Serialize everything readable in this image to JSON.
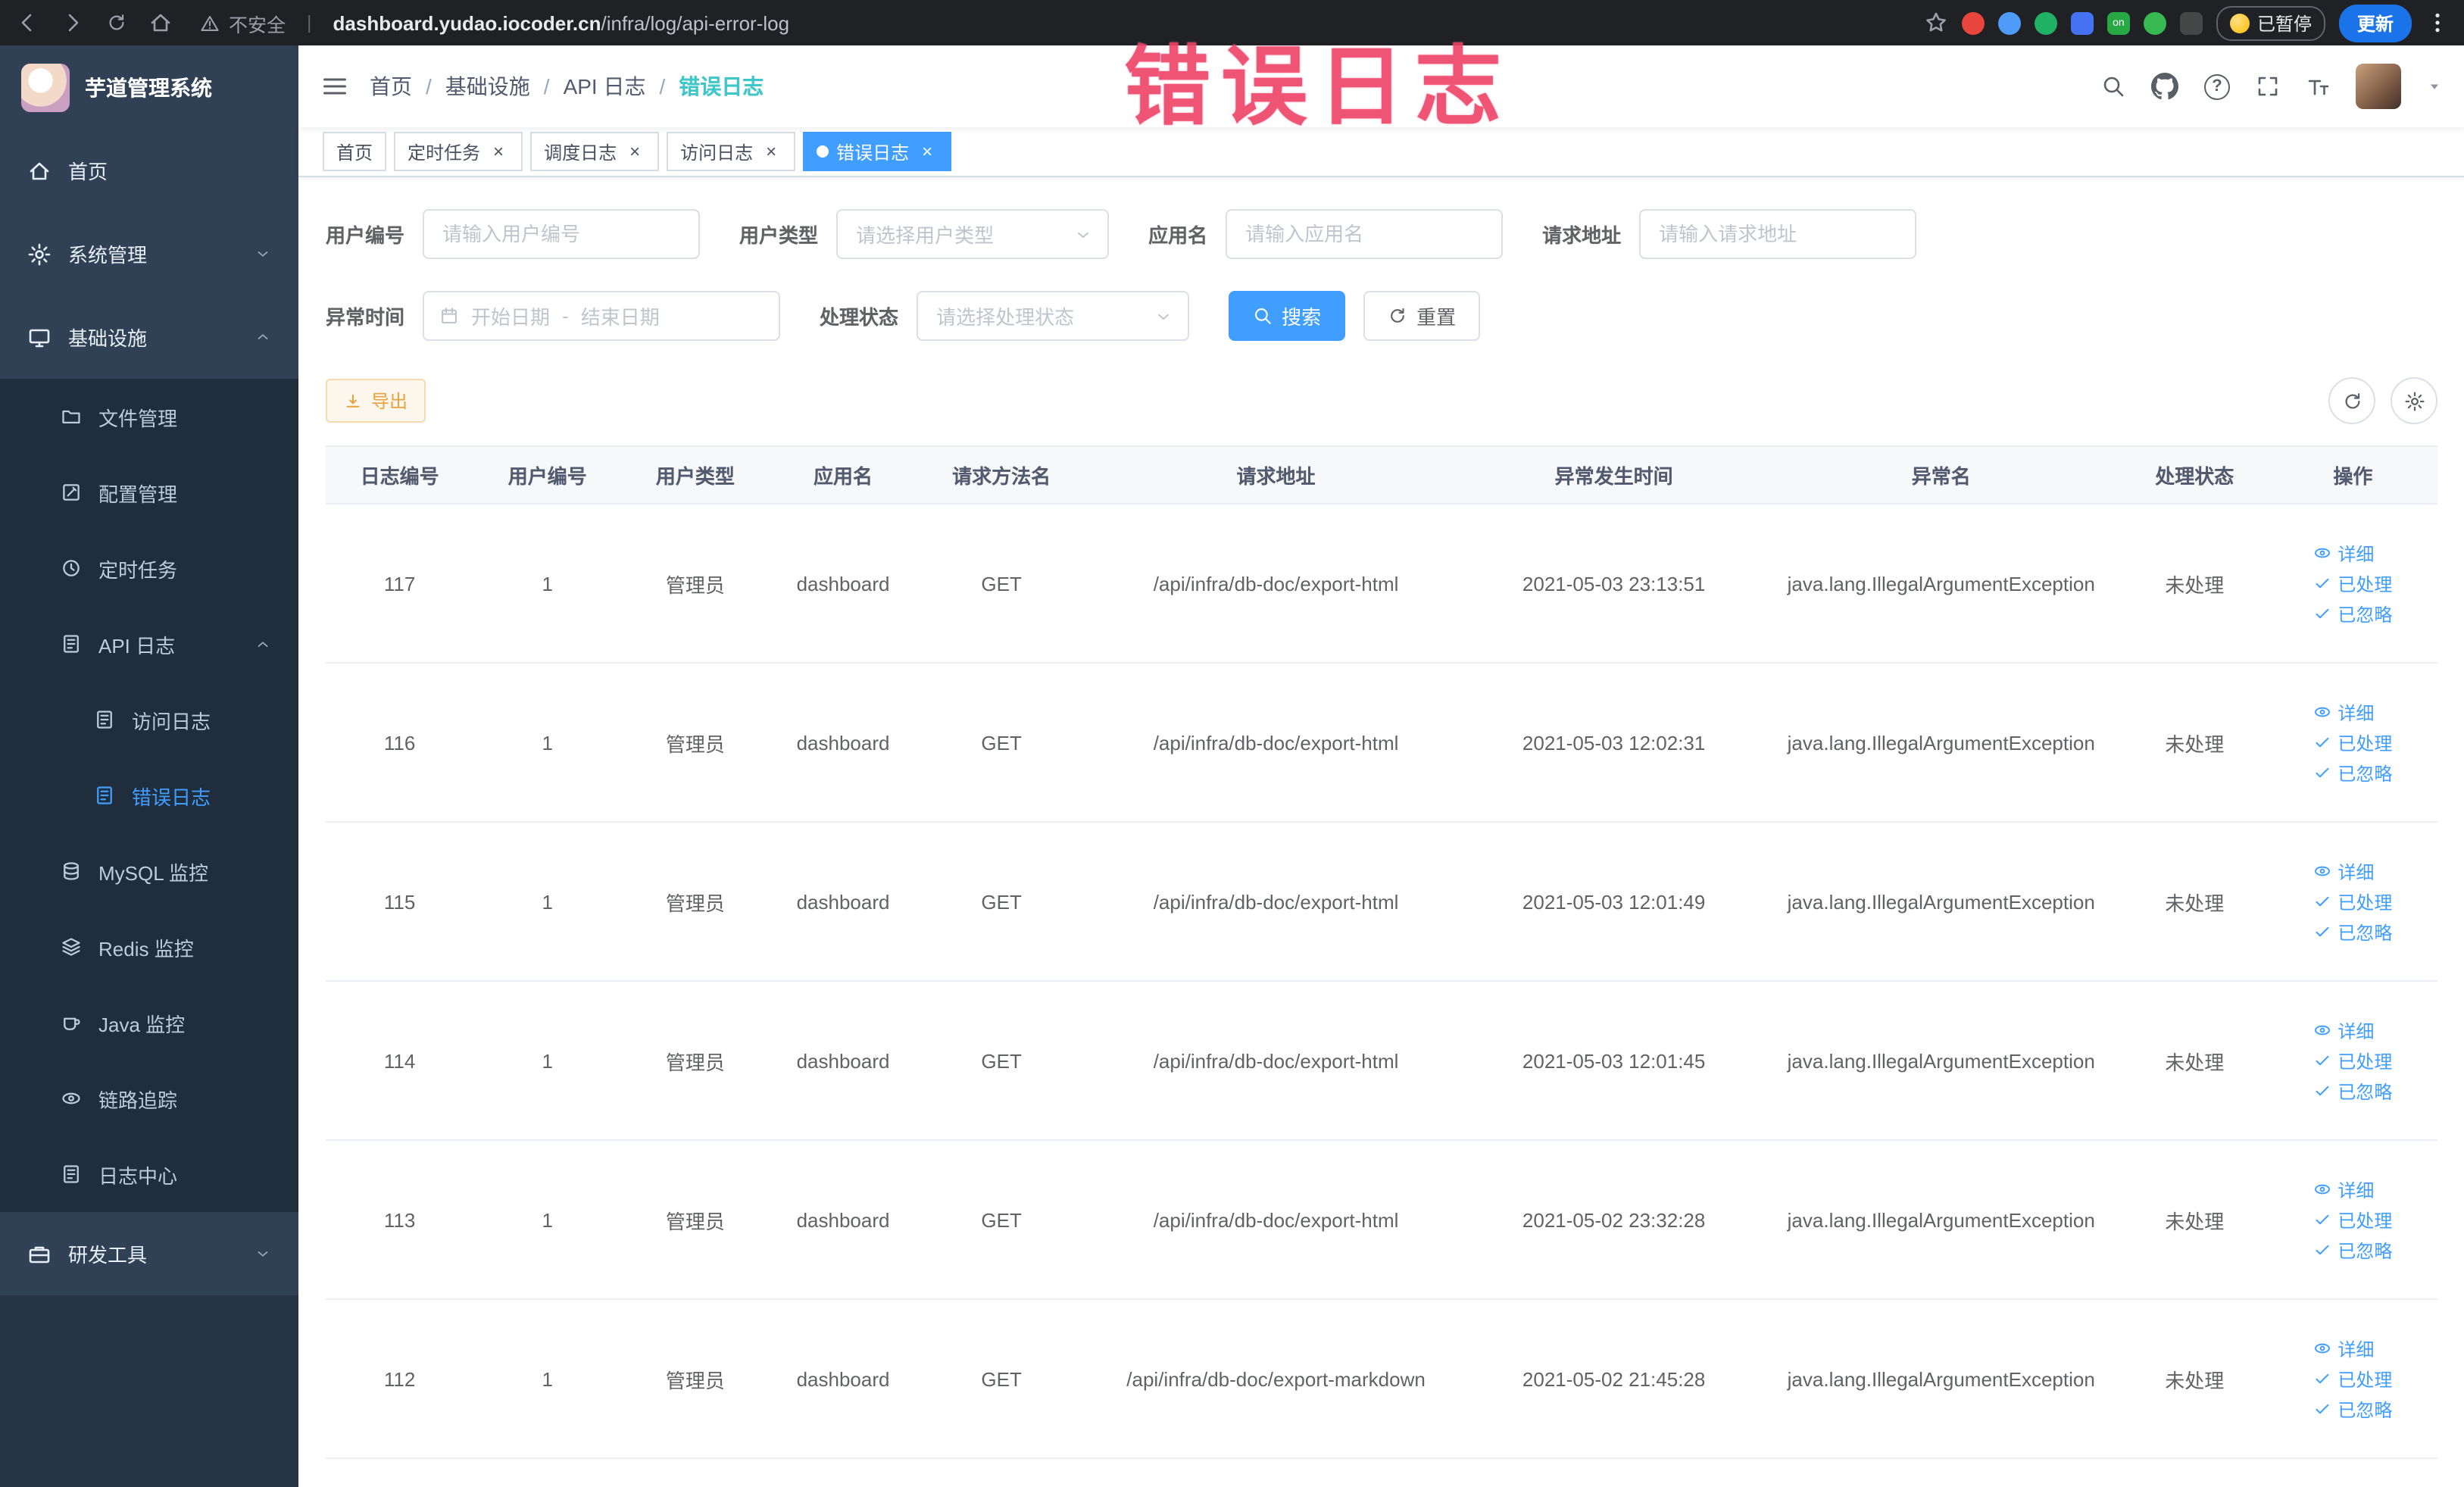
{
  "browser": {
    "security_label": "不安全",
    "url_domain": "dashboard.yudao.iocoder.cn",
    "url_path": "/infra/log/api-error-log",
    "extension_on_label": "on",
    "paused_badge": "已暂停",
    "update_button": "更新"
  },
  "annotation": {
    "text": "错误日志"
  },
  "glyphs": {
    "close": "×",
    "question": "?"
  },
  "sidebar": {
    "title": "芋道管理系统",
    "home": "首页",
    "system_mgmt": "系统管理",
    "infrastructure": "基础设施",
    "file_mgmt": "文件管理",
    "config_mgmt": "配置管理",
    "scheduled_jobs": "定时任务",
    "api_logs": "API 日志",
    "access_log": "访问日志",
    "error_log": "错误日志",
    "mysql_monitor": "MySQL 监控",
    "redis_monitor": "Redis 监控",
    "java_monitor": "Java 监控",
    "trace": "链路追踪",
    "log_center": "日志中心",
    "dev_tools": "研发工具"
  },
  "header": {
    "breadcrumb": [
      "首页",
      "基础设施",
      "API 日志",
      "错误日志"
    ],
    "breadcrumb_separator": "/"
  },
  "tags": {
    "items": [
      {
        "label": "首页"
      },
      {
        "label": "定时任务"
      },
      {
        "label": "调度日志"
      },
      {
        "label": "访问日志"
      },
      {
        "label": "错误日志"
      }
    ]
  },
  "filters": {
    "user_id_label": "用户编号",
    "user_id_placeholder": "请输入用户编号",
    "user_type_label": "用户类型",
    "user_type_placeholder": "请选择用户类型",
    "app_name_label": "应用名",
    "app_name_placeholder": "请输入应用名",
    "request_url_label": "请求地址",
    "request_url_placeholder": "请输入请求地址",
    "exception_time_label": "异常时间",
    "start_date_placeholder": "开始日期",
    "date_separator": "-",
    "end_date_placeholder": "结束日期",
    "process_status_label": "处理状态",
    "process_status_placeholder": "请选择处理状态",
    "search_button": "搜索",
    "reset_button": "重置"
  },
  "toolbar": {
    "export_button": "导出"
  },
  "table": {
    "columns": [
      "日志编号",
      "用户编号",
      "用户类型",
      "应用名",
      "请求方法名",
      "请求地址",
      "异常发生时间",
      "异常名",
      "处理状态",
      "操作"
    ],
    "actions": {
      "detail": "详细",
      "processed": "已处理",
      "ignored": "已忽略"
    },
    "rows": [
      {
        "log_id": "117",
        "user_id": "1",
        "user_type": "管理员",
        "app_name": "dashboard",
        "method": "GET",
        "url": "/api/infra/db-doc/export-html",
        "time": "2021-05-03 23:13:51",
        "exception": "java.lang.IllegalArgumentException",
        "status": "未处理"
      },
      {
        "log_id": "116",
        "user_id": "1",
        "user_type": "管理员",
        "app_name": "dashboard",
        "method": "GET",
        "url": "/api/infra/db-doc/export-html",
        "time": "2021-05-03 12:02:31",
        "exception": "java.lang.IllegalArgumentException",
        "status": "未处理"
      },
      {
        "log_id": "115",
        "user_id": "1",
        "user_type": "管理员",
        "app_name": "dashboard",
        "method": "GET",
        "url": "/api/infra/db-doc/export-html",
        "time": "2021-05-03 12:01:49",
        "exception": "java.lang.IllegalArgumentException",
        "status": "未处理"
      },
      {
        "log_id": "114",
        "user_id": "1",
        "user_type": "管理员",
        "app_name": "dashboard",
        "method": "GET",
        "url": "/api/infra/db-doc/export-html",
        "time": "2021-05-03 12:01:45",
        "exception": "java.lang.IllegalArgumentException",
        "status": "未处理"
      },
      {
        "log_id": "113",
        "user_id": "1",
        "user_type": "管理员",
        "app_name": "dashboard",
        "method": "GET",
        "url": "/api/infra/db-doc/export-html",
        "time": "2021-05-02 23:32:28",
        "exception": "java.lang.IllegalArgumentException",
        "status": "未处理"
      },
      {
        "log_id": "112",
        "user_id": "1",
        "user_type": "管理员",
        "app_name": "dashboard",
        "method": "GET",
        "url": "/api/infra/db-doc/export-markdown",
        "time": "2021-05-02 21:45:28",
        "exception": "java.lang.IllegalArgumentException",
        "status": "未处理"
      }
    ]
  },
  "colors": {
    "primary": "#409EFF",
    "warning": "#E6A23C",
    "sidebar_bg": "#304156",
    "submenu_bg": "#1F2D3D",
    "chrome_bg": "#202124",
    "annotation": "#EE4266",
    "breadcrumb_current": "#3EC6C8"
  }
}
